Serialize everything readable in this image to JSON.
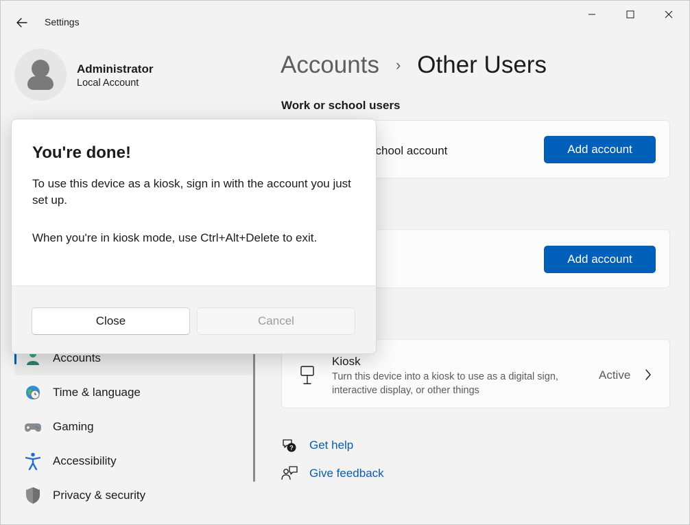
{
  "window": {
    "app_title": "Settings"
  },
  "profile": {
    "name": "Administrator",
    "account_type": "Local Account"
  },
  "nav": {
    "items": [
      {
        "label": "Accounts",
        "icon": "accounts-icon",
        "selected": true
      },
      {
        "label": "Time & language",
        "icon": "globe-clock-icon"
      },
      {
        "label": "Gaming",
        "icon": "gamepad-icon"
      },
      {
        "label": "Accessibility",
        "icon": "accessibility-icon"
      },
      {
        "label": "Privacy & security",
        "icon": "shield-icon"
      }
    ]
  },
  "breadcrumb": {
    "parent": "Accounts",
    "separator": "›",
    "current": "Other Users"
  },
  "sections": {
    "work_school_title": "Work or school users",
    "work_school_card_text": "school account",
    "add_account_label": "Add account"
  },
  "kiosk": {
    "title": "Kiosk",
    "description": "Turn this device into a kiosk to use as a digital sign, interactive display, or other things",
    "status": "Active"
  },
  "links": {
    "help": "Get help",
    "feedback": "Give feedback"
  },
  "dialog": {
    "title": "You're done!",
    "line1": "To use this device as a kiosk, sign in with the account you just set up.",
    "line2": "When you're in kiosk mode, use Ctrl+Alt+Delete to exit.",
    "primary_button": "Close",
    "secondary_button": "Cancel"
  },
  "colors": {
    "accent": "#005fb8",
    "link": "#0a5cad",
    "background": "#f3f3f3"
  }
}
